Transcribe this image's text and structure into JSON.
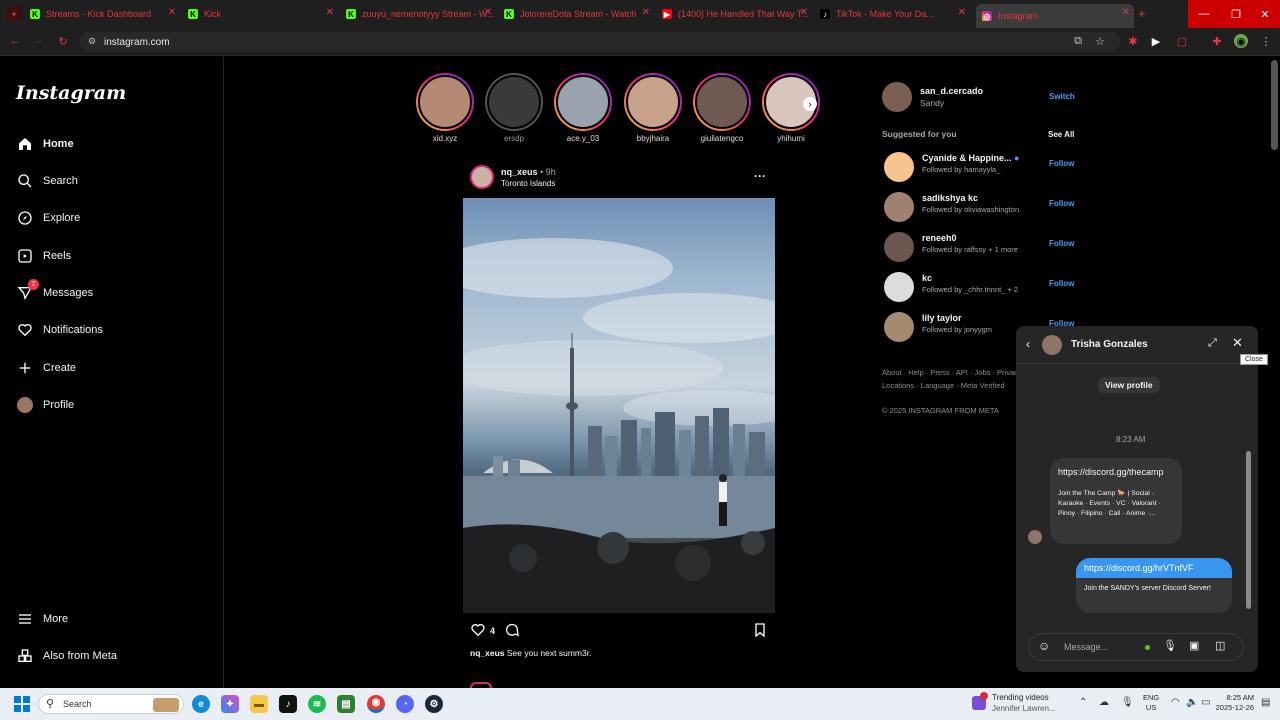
{
  "browser": {
    "tabs": [
      {
        "title": "Streams - Kick Dashboard",
        "favicon": "kick-icon"
      },
      {
        "title": "Kick",
        "favicon": "kick-icon"
      },
      {
        "title": "zuuyu_nemenotyyy Stream - W...",
        "favicon": "kick-icon"
      },
      {
        "title": "JolorereDota Stream - Watch",
        "favicon": "kick-icon"
      },
      {
        "title": "(1400) He Handled That Way T...",
        "favicon": "youtube-icon"
      },
      {
        "title": "TikTok - Make Your Da...",
        "favicon": "tiktok-icon"
      },
      {
        "title": "Instagram",
        "favicon": "instagram-icon"
      }
    ],
    "new_tab": "+",
    "url": "instagram.com"
  },
  "sidebar": {
    "logo": "Instagram",
    "items": [
      {
        "label": "Home",
        "icon": "home-icon"
      },
      {
        "label": "Search",
        "icon": "search-icon"
      },
      {
        "label": "Explore",
        "icon": "compass-icon"
      },
      {
        "label": "Reels",
        "icon": "reels-icon"
      },
      {
        "label": "Messages",
        "icon": "messages-icon",
        "badge": "2"
      },
      {
        "label": "Notifications",
        "icon": "heart-icon"
      },
      {
        "label": "Create",
        "icon": "plus-icon"
      },
      {
        "label": "Profile",
        "icon": "avatar"
      }
    ],
    "bottom": [
      {
        "label": "More",
        "icon": "menu-icon"
      },
      {
        "label": "Also from Meta",
        "icon": "meta-apps-icon"
      }
    ]
  },
  "stories": [
    {
      "name": "xid.xyz"
    },
    {
      "name": "ersdp"
    },
    {
      "name": "ace.y_03"
    },
    {
      "name": "bbyjhaira"
    },
    {
      "name": "giuliatengco"
    },
    {
      "name": "yhihumi"
    }
  ],
  "post": {
    "author": "nq_xeus",
    "time": "• 9h",
    "location": "Toronto Islands",
    "more": "···",
    "likes": "4",
    "caption_author": "nq_xeus",
    "caption": "See you next summ3r."
  },
  "account": {
    "username": "san_d.cercado",
    "display_name": "Sandy",
    "switch": "Switch"
  },
  "suggestions": {
    "title": "Suggested for you",
    "see_all": "See All",
    "items": [
      {
        "name": "Cyanide & Happine...",
        "sub": "Followed by hamayyla_",
        "action": "Follow"
      },
      {
        "name": "sadikshya kc",
        "sub": "Followed by oliviawashington",
        "action": "Follow"
      },
      {
        "name": "reneeh0",
        "sub": "Followed by raffssy + 1 more",
        "action": "Follow"
      },
      {
        "name": "kc",
        "sub": "Followed by _chhr.tnnnt_ + 2",
        "action": "Follow"
      },
      {
        "name": "lily taylor",
        "sub": "Followed by jonyygm",
        "action": "Follow"
      }
    ]
  },
  "footer": {
    "links": "About · Help · Press · API · Jobs · Privacy",
    "links2": "Locations · Language · Meta Verified",
    "copyright": "© 2025 INSTAGRAM FROM META"
  },
  "chat": {
    "name": "Trisha Gonzales",
    "close_tooltip": "Close",
    "view_profile": "View profile",
    "timestamp": "8:23 AM",
    "incoming_link": "https://discord.gg/thecamp",
    "incoming_preview": "Join the The Camp 🐎 | Social · Karaoke · Events · VC · Valorant · Pinoy · Filipino · Call · Anime ·...",
    "outgoing_link": "https://discord.gg/hrVTnfVF",
    "outgoing_preview": "Join the SANDY's server Discord Server!",
    "placeholder": "Message..."
  },
  "taskbar": {
    "search": "Search",
    "notif_title": "Trending videos",
    "notif_sub": "Jennifer Lawren...",
    "lang1": "ENG",
    "lang2": "US",
    "time": "8:25 AM",
    "date": "2025-12-26"
  }
}
